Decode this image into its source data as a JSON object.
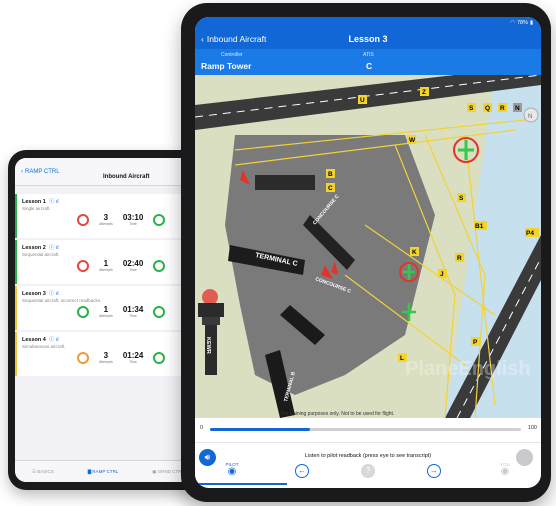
{
  "back_app": {
    "nav": {
      "back_label": "RAMP CTRL",
      "title": "Inbound Aircraft"
    },
    "lessons": [
      {
        "title": "Lesson 1",
        "desc": "Single aircraft.",
        "attempts": "3",
        "time": "03:10",
        "status": "green"
      },
      {
        "title": "Lesson 2",
        "desc": "Sequential aircraft.",
        "attempts": "1",
        "time": "02:40",
        "status": "green"
      },
      {
        "title": "Lesson 3",
        "desc": "Sequential aircraft, incorrect readbacks.",
        "attempts": "1",
        "time": "01:34",
        "status": "yellow"
      },
      {
        "title": "Lesson 4",
        "desc": "Simultaneous aircraft.",
        "attempts": "3",
        "time": "01:24",
        "status": "yellow"
      }
    ],
    "stat_labels": {
      "attempts": "Attempts",
      "time": "Time"
    },
    "tabbar": [
      "BASICS",
      "RAMP CTRL",
      "GRND CTRL"
    ]
  },
  "front_app": {
    "status": {
      "battery": "78%"
    },
    "nav": {
      "back_label": "Inbound Aircraft",
      "title": "Lesson 3"
    },
    "info": {
      "controller_label": "Controller",
      "controller_value": "Ramp Tower",
      "atis_label": "ATIS",
      "atis_value": "C"
    },
    "map": {
      "terminal_c": "TERMINAL C",
      "terminal_b": "TERMINAL B",
      "concourse_c1": "CONCOURSE C",
      "concourse_c2": "CONCOURSE C",
      "tower_code": "KEWR",
      "taxiways": [
        "U",
        "S",
        "Q",
        "R",
        "N",
        "W",
        "Z",
        "K",
        "J",
        "R",
        "P",
        "L",
        "B",
        "P4",
        "S",
        "C",
        "B1"
      ],
      "disclaimer": "For training purposes only. Not to be used for flight.",
      "watermark": "PlaneEnglish"
    },
    "slider": {
      "min": "0",
      "max": "100",
      "value_pct": 0.32
    },
    "bottom": {
      "message": "Listen to pilot readback (press eye to see transcript)",
      "pilot_label": "PILOT",
      "you_label": "YOU"
    }
  }
}
